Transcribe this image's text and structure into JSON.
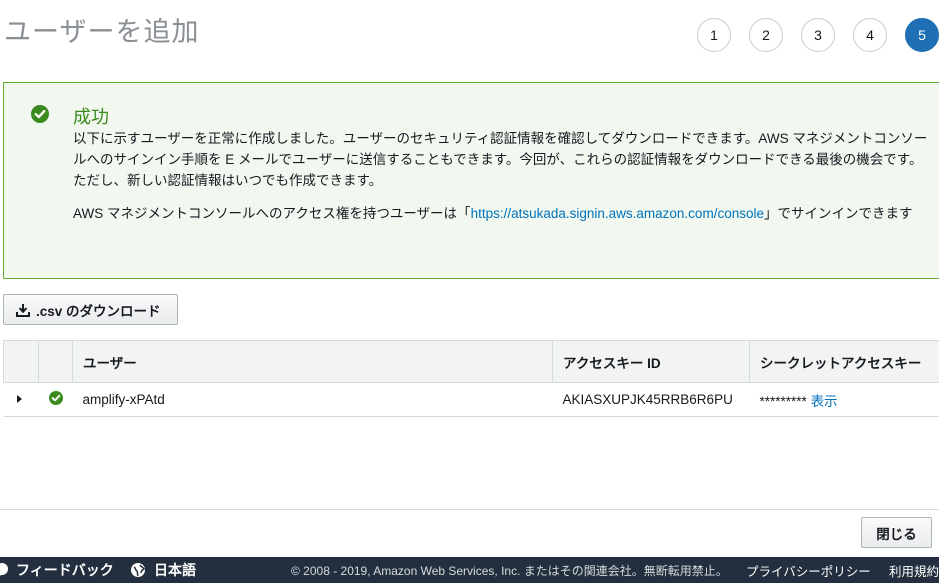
{
  "page": {
    "title": "ユーザーを追加"
  },
  "steps": [
    "1",
    "2",
    "3",
    "4",
    "5"
  ],
  "alert": {
    "title": "成功",
    "paragraph1": "以下に示すユーザーを正常に作成しました。ユーザーのセキュリティ認証情報を確認してダウンロードできます。AWS マネジメントコンソールへのサインイン手順を E メールでユーザーに送信することもできます。今回が、これらの認証情報をダウンロードできる最後の機会です。ただし、新しい認証情報はいつでも作成できます。",
    "paragraph2_prefix": "AWS マネジメントコンソールへのアクセス権を持つユーザーは「",
    "paragraph2_link": "https://atsukada.signin.aws.amazon.com/console",
    "paragraph2_suffix": "」でサインインできます"
  },
  "csv_button": {
    "label": ".csv のダウンロード",
    "icon": "download-icon"
  },
  "table": {
    "headers": [
      "",
      "",
      "ユーザー",
      "アクセスキー ID",
      "シークレットアクセスキー"
    ],
    "rows": [
      {
        "user": "amplify-xPAtd",
        "access_key_id": "AKIASXUPJK45RRB6R6PU",
        "secret_masked": "*********",
        "secret_show": "表示"
      }
    ]
  },
  "close_button": {
    "label": "閉じる"
  },
  "footer": {
    "feedback": "フィードバック",
    "language": "日本語",
    "copyright": "© 2008 - 2019, Amazon Web Services, Inc. またはその関連会社。無断転用禁止。",
    "privacy": "プライバシーポリシー",
    "terms": "利用規約"
  },
  "colors": {
    "success": "#3a8a1e",
    "link": "#0073bb",
    "active_step": "#1f6fb5",
    "footer_bg": "#232f3e"
  }
}
